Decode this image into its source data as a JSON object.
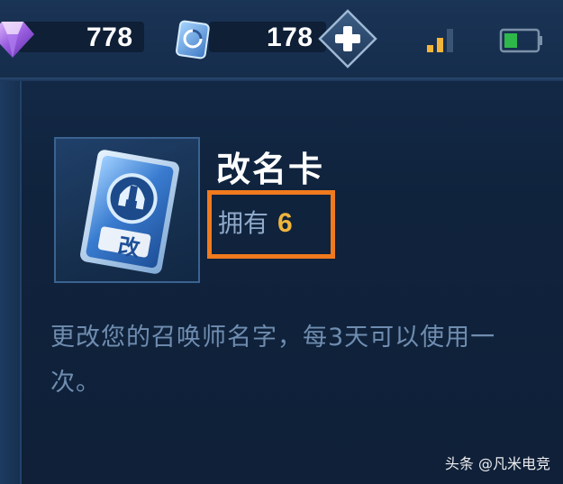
{
  "topbar": {
    "gem_count": "778",
    "coupon_count": "178",
    "icons": {
      "gem": "purple-diamond-icon",
      "coupon": "rename-coupon-icon",
      "plus": "plus-icon",
      "signal": "signal-strength-icon",
      "battery": "battery-icon"
    },
    "signal_bars_active": 2,
    "signal_bars_total": 3,
    "battery_level": 0.35
  },
  "item": {
    "icon": "rename-card-icon",
    "card_glyph": "改",
    "title": "改名卡",
    "owned_label": "拥有",
    "owned_count": "6",
    "description": "更改您的召唤师名字，每3天可以使用一次。"
  },
  "watermark": "头条 @凡米电竞",
  "colors": {
    "highlight": "#f07a1e",
    "owned_count": "#f0b43c",
    "description": "#6f8db0"
  }
}
